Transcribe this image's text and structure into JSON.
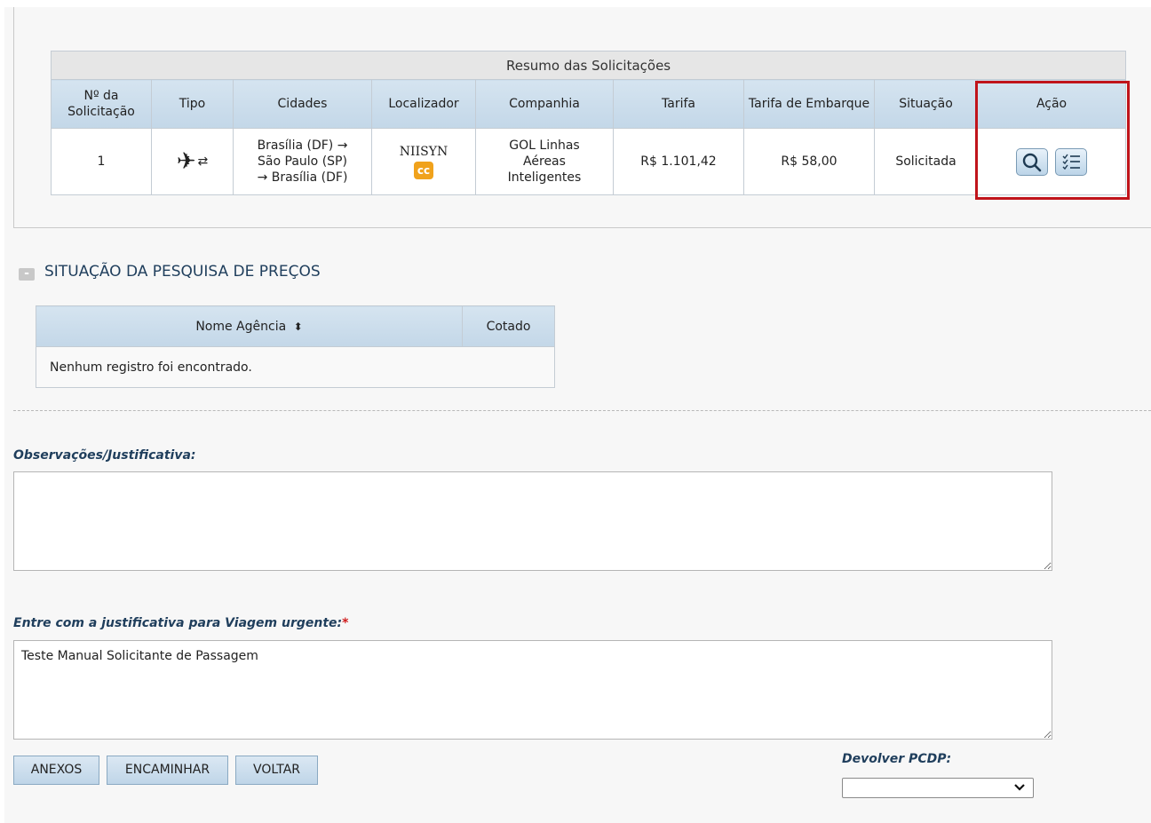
{
  "summary": {
    "caption": "Resumo das Solicitações",
    "headers": {
      "numero": "Nº da Solicitação",
      "tipo": "Tipo",
      "cidades": "Cidades",
      "localizador": "Localizador",
      "companhia": "Companhia",
      "tarifa": "Tarifa",
      "tarifa_embarque": "Tarifa de Embarque",
      "situacao": "Situação",
      "acao": "Ação"
    },
    "rows": [
      {
        "numero": "1",
        "tipo_icon": "airplane-icon",
        "tipo_extra_icon": "round-trip-arrows-icon",
        "cidades": [
          "Brasília (DF) →",
          "São Paulo (SP)",
          "→ Brasília (DF)"
        ],
        "localizador": "NIISYN",
        "badge": "cc",
        "companhia": [
          "GOL Linhas",
          "Aéreas",
          "Inteligentes"
        ],
        "tarifa": "R$ 1.101,42",
        "tarifa_embarque": "R$ 58,00",
        "situacao": "Solicitada",
        "actions": [
          "search-icon",
          "checklist-icon"
        ]
      }
    ],
    "highlight_color": "#c0141b"
  },
  "pesquisa": {
    "toggle": "-",
    "title": "SITUAÇÃO DA PESQUISA DE PREÇOS",
    "headers": {
      "nome": "Nome Agência",
      "cotado": "Cotado"
    },
    "sort_icon": "sort-icon",
    "empty": "Nenhum registro foi encontrado."
  },
  "form": {
    "obs_label": "Observações/Justificativa:",
    "obs_value": "",
    "urgente_label": "Entre com a justificativa para Viagem urgente:",
    "urgente_required": "*",
    "urgente_value": "Teste Manual Solicitante de Passagem"
  },
  "buttons": {
    "anexos": "ANEXOS",
    "encaminhar": "ENCAMINHAR",
    "voltar": "VOLTAR"
  },
  "devolver": {
    "label": "Devolver PCDP:",
    "selected": ""
  },
  "colors": {
    "header_blue": "#c3d7e8",
    "label_blue": "#1f3e5c",
    "badge_orange": "#f0a21c"
  }
}
